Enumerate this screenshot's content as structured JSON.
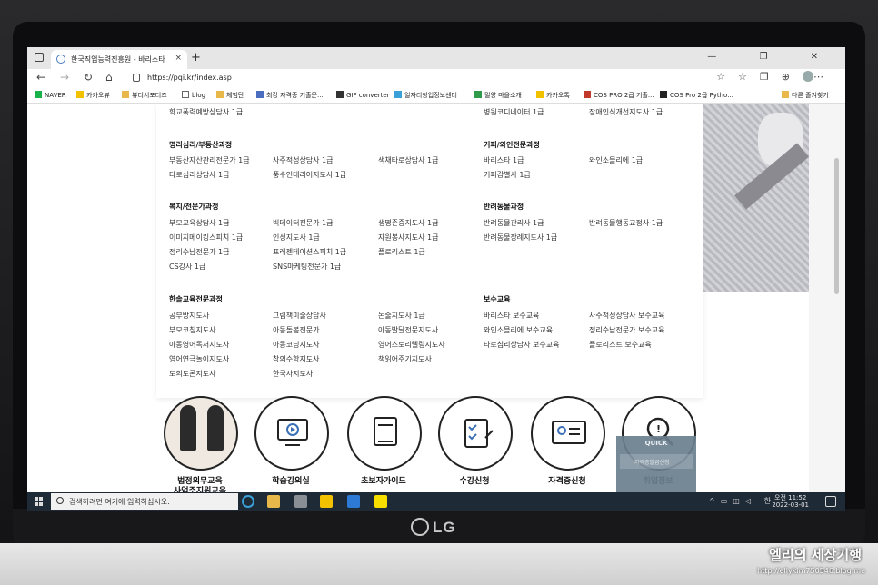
{
  "browser": {
    "tab_title": "한국직업능력진흥원 - 바리스타",
    "tab_close": "×",
    "new_tab": "+",
    "url": "https://pqi.kr/index.asp",
    "window_controls": "— ❐ ✕"
  },
  "bookmarks": [
    {
      "label": "NAVER",
      "color": "#19b14a"
    },
    {
      "label": "카카오뷰",
      "color": "#f2c200"
    },
    {
      "label": "뷰티서포터즈",
      "color": "#e8b84a"
    },
    {
      "label": "blog",
      "color": "#ffffff"
    },
    {
      "label": "체험단",
      "color": "#e8b84a"
    },
    {
      "label": "최강 자격증 기출문...",
      "color": "#4a6dbf"
    },
    {
      "label": "GIF converter",
      "color": "#333333"
    },
    {
      "label": "일자리창업정보센터",
      "color": "#3aa0d8"
    },
    {
      "label": "밀양 마을소개",
      "color": "#2f9a4a"
    },
    {
      "label": "카카오톡",
      "color": "#f2c200"
    },
    {
      "label": "COS PRO 2급 기출...",
      "color": "#c0392b"
    },
    {
      "label": "COS Pro 2급 Pytho...",
      "color": "#222222"
    },
    {
      "label": "다른 즐겨찾기",
      "color": "#e8b84a"
    }
  ],
  "menu": {
    "top_row": [
      "학교폭력예방상담사 1급",
      "병원코디네이터 1급",
      "장애인식개선지도사 1급"
    ],
    "sections": [
      {
        "title": "명리심리/부동산과정",
        "items": [
          "부동산자산관리전문가 1급",
          "사주적성상담사 1급",
          "색채타로상담사 1급",
          "타로심리상담사 1급",
          "풍수인테리어지도사 1급"
        ]
      },
      {
        "title": "커피/와인전문과정",
        "items": [
          "바리스타 1급",
          "와인소믈리에 1급",
          "커피감별사 1급"
        ]
      },
      {
        "title": "복지/전문가과정",
        "items": [
          "부모교육상담사 1급",
          "빅데이터전문가 1급",
          "생명존중지도사 1급",
          "이미지메이킹스피치 1급",
          "인성지도사 1급",
          "자원봉사지도사 1급",
          "정리수납전문가 1급",
          "프레젠테이션스피치 1급",
          "플로리스트 1급",
          "CS강사 1급",
          "SNS마케팅전문가 1급"
        ]
      },
      {
        "title": "반려동물과정",
        "items": [
          "반려동물관리사 1급",
          "반려동물행동교정사 1급",
          "반려동물장례지도사 1급"
        ]
      },
      {
        "title": "한솔교육전문과정",
        "items": [
          "공부방지도사",
          "그림책미술상담사",
          "논술지도사 1급",
          "부모코칭지도사",
          "아동돌봄전문가",
          "아동발달전문지도사",
          "아동영어독서지도사",
          "아동코딩지도사",
          "영어스토리텔링지도사",
          "영어연극놀이지도사",
          "창의수학지도사",
          "책읽어주기지도사",
          "토의토론지도사",
          "한국사지도사"
        ]
      },
      {
        "title": "보수교육",
        "items": [
          "바리스타 보수교육",
          "사주적성상담사 보수교육",
          "와인소믈리에 보수교육",
          "정리수납전문가 보수교육",
          "타로심리상담사 보수교육",
          "플로리스트 보수교육"
        ]
      }
    ]
  },
  "quick_nav": [
    {
      "label": "법정의무교육",
      "label2": "사업주지원교육"
    },
    {
      "label": "학습강의실"
    },
    {
      "label": "초보자가이드"
    },
    {
      "label": "수강신청"
    },
    {
      "label": "자격증신청"
    },
    {
      "label": "취업정보"
    }
  ],
  "quick_panel": {
    "title": "QUICK",
    "row": "자격증발급신청"
  },
  "taskbar": {
    "search_placeholder": "검색하려면 여기에 입력하십시오.",
    "time": "오전 11:52",
    "date": "2022-03-01",
    "ime": "한"
  },
  "hardware": {
    "brand": "LG"
  },
  "watermark": {
    "title": "엘리의 세상기행",
    "url": "http://ellykim750546.blog.me"
  }
}
